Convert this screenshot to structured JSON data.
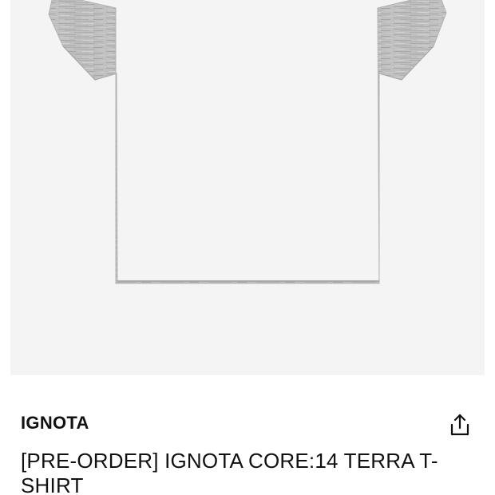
{
  "product": {
    "image_alt": "grey melange t-shirt",
    "shirt_color": "#bdbdbd",
    "background_color": "#f4f4f4",
    "brand": "IGNOTA",
    "title": "[PRE-ORDER] IGNOTA CORE:14 TERRA T-SHIRT"
  },
  "actions": {
    "share_icon": "share-icon"
  }
}
